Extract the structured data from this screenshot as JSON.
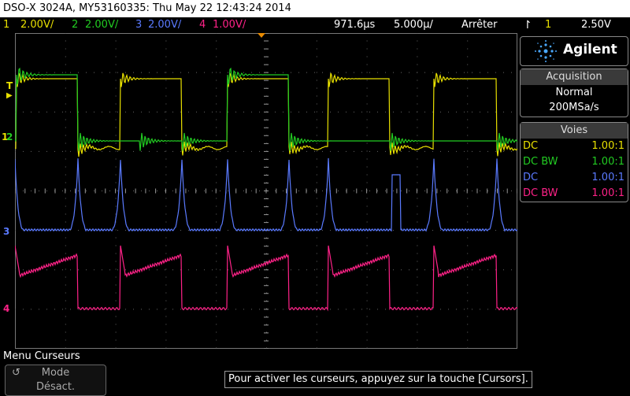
{
  "title": "DSO-X 3024A, MY53160335: Thu May 22 12:43:24 2014",
  "status": {
    "ch1": {
      "num": "1",
      "scale": "2.00V/",
      "color": "#e8e000"
    },
    "ch2": {
      "num": "2",
      "scale": "2.00V/",
      "color": "#22cc22"
    },
    "ch3": {
      "num": "3",
      "scale": "2.00V/",
      "color": "#5a7aff"
    },
    "ch4": {
      "num": "4",
      "scale": "1.00V/",
      "color": "#ff2288"
    },
    "delay": "971.6µs",
    "timebase": "5.000µ/",
    "run_state": "Arrêter",
    "trig_ch": "1",
    "trig_level": "2.50V"
  },
  "brand": "Agilent",
  "acquisition": {
    "header": "Acquisition",
    "mode": "Normal",
    "rate": "200MSa/s"
  },
  "channels": {
    "header": "Voies",
    "rows": [
      {
        "coupling": "DC",
        "probe": "1.00:1",
        "color": "#e8e000"
      },
      {
        "coupling": "DC BW",
        "probe": "1.00:1",
        "color": "#22cc22"
      },
      {
        "coupling": "DC",
        "probe": "1.00:1",
        "color": "#5a7aff"
      },
      {
        "coupling": "DC BW",
        "probe": "1.00:1",
        "color": "#ff2288"
      }
    ]
  },
  "markers": {
    "trigger": "T",
    "ch1": "1",
    "ch2": "2",
    "ch3": "3",
    "ch4": "4"
  },
  "menu": {
    "title": "Menu Curseurs",
    "softkey_line1": "Mode",
    "softkey_line2": "Désact.",
    "softkey_symbol": "↺"
  },
  "message": "Pour activer les curseurs, appuyez sur la touche [Cursors]."
}
